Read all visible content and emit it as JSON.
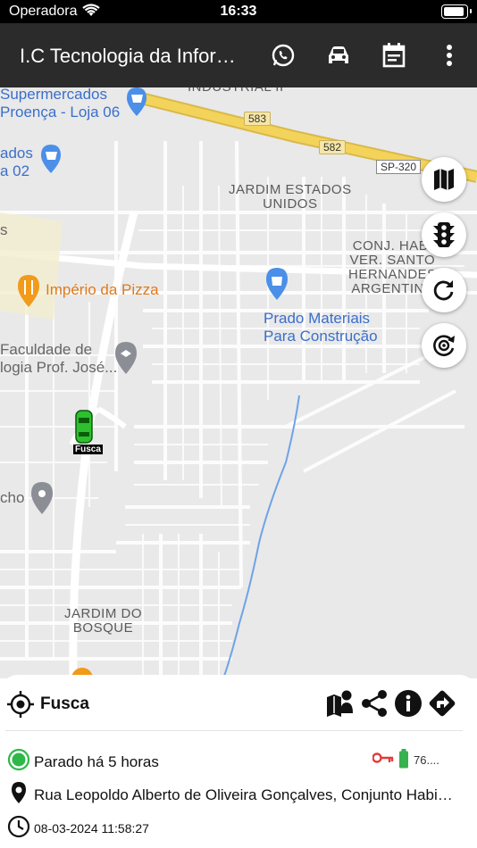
{
  "status_bar": {
    "carrier": "Operadora",
    "time": "16:33"
  },
  "app_bar": {
    "title": "I.C Tecnologia da Informação",
    "actions": [
      "whatsapp-icon",
      "car-icon",
      "calendar-icon",
      "more-vert-icon"
    ]
  },
  "map": {
    "places": {
      "supermarket": "Supermercados\nProença - Loja 06",
      "industrial": "INDUSTRIAL II",
      "left_store": "ados\na 02",
      "jardim_estados": "JARDIM ESTADOS\nUNIDOS",
      "conj_hab": "CONJ. HAB.\nVER. SANTO\nHERNANDES\nARGENTINA",
      "pizza": "Império da Pizza",
      "prado": "Prado Materiais\nPara Construção",
      "faculdade": "Faculdade de\nlogia Prof. José...",
      "cho": "cho",
      "s_letter": "s",
      "jardim_bosque": "JARDIM DO\nBOSQUE"
    },
    "roads": {
      "r583": "583",
      "r582": "582",
      "sp320": "SP-320"
    },
    "vehicle_label": "Fusca",
    "controls": [
      "map-icon",
      "traffic-light-icon",
      "refresh-icon",
      "rotate-icon"
    ]
  },
  "vehicle": {
    "name": "Fusca",
    "status": "Parado há 5 horas",
    "voltage": "76....",
    "address": "Rua Leopoldo Alberto de Oliveira Gonçalves, Conjunto Habitacional",
    "timestamp": "08-03-2024 11:58:27",
    "actions": [
      "street-view-icon",
      "share-icon",
      "info-icon",
      "directions-icon"
    ]
  },
  "colors": {
    "appbar": "#2b2b2b",
    "status_ok": "#2fb84a",
    "key": "#e23b3b",
    "battery": "#37b24d",
    "route_water": "#6fa3e6",
    "highway": "#f3d35a"
  }
}
